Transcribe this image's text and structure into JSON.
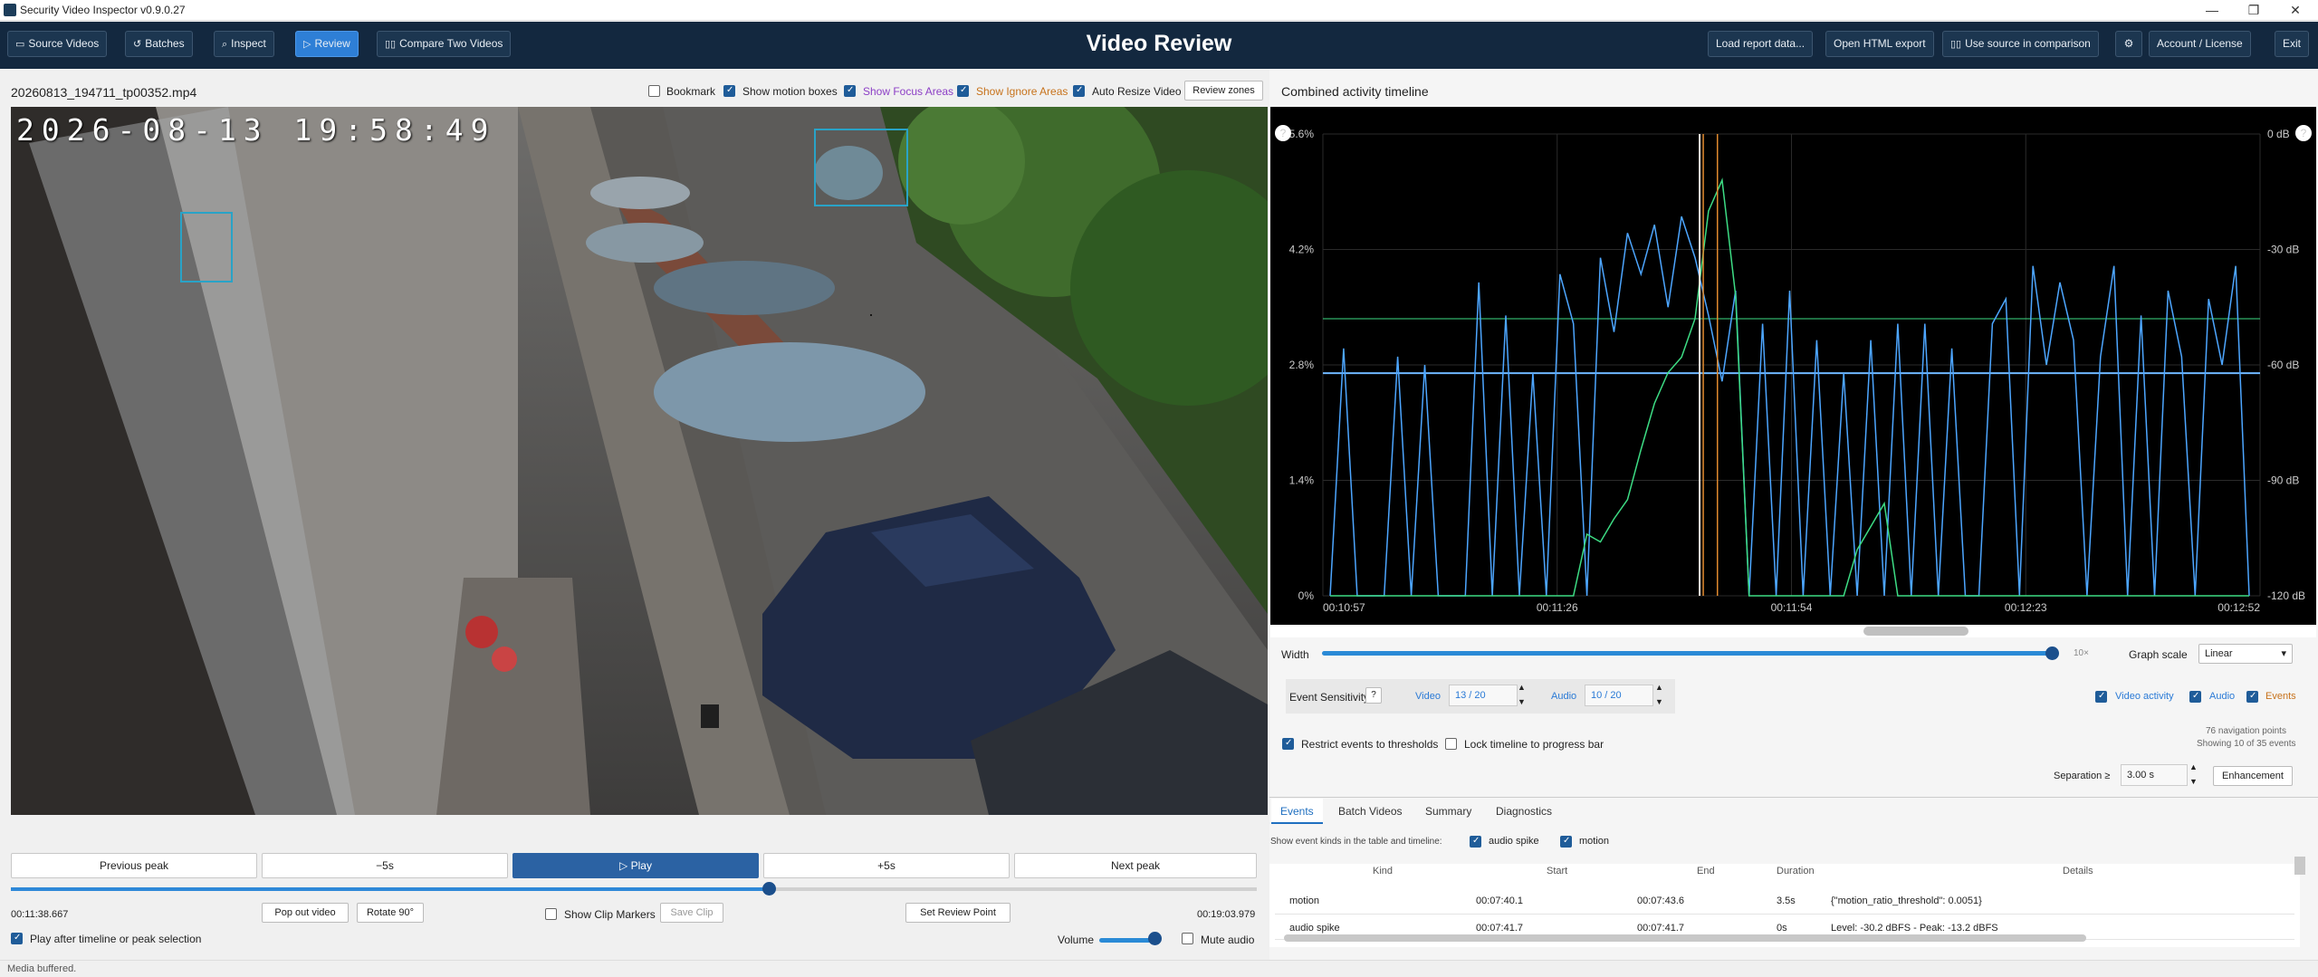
{
  "window": {
    "title": "Security Video Inspector v0.9.0.27",
    "minimize": "—",
    "maximize": "❐",
    "close": "✕"
  },
  "toolbar": {
    "source_videos": "Source Videos",
    "batches": "Batches",
    "inspect": "Inspect",
    "review": "Review",
    "compare": "Compare Two Videos",
    "title": "Video Review",
    "load_report": "Load report data...",
    "open_html": "Open HTML export",
    "use_source": "Use source in comparison",
    "account": "Account / License",
    "exit": "Exit"
  },
  "video": {
    "filename": "20260813_194711_tp00352.mp4",
    "timestamp_overlay": "2026-08-13 19:58:49",
    "options": {
      "bookmark": "Bookmark",
      "show_motion_boxes": "Show motion boxes",
      "show_focus_areas": "Show Focus Areas",
      "show_ignore_areas": "Show Ignore Areas",
      "auto_resize": "Auto Resize Video",
      "review_zones": "Review zones"
    },
    "option_states": {
      "bookmark": false,
      "show_motion_boxes": true,
      "show_focus_areas": true,
      "show_ignore_areas": true,
      "auto_resize": true
    }
  },
  "playback": {
    "previous_peak": "Previous peak",
    "back5": "−5s",
    "play": "Play",
    "fwd5": "+5s",
    "next_peak": "Next peak",
    "current_time": "00:11:38.667",
    "total_time": "00:19:03.979",
    "progress_fraction": 0.61,
    "pop_out": "Pop out video",
    "rotate": "Rotate 90°",
    "show_clip_markers": "Show Clip Markers",
    "save_clip": "Save Clip",
    "set_review_point": "Set Review Point",
    "play_after": "Play after timeline or peak selection",
    "volume": "Volume",
    "volume_fraction": 0.85,
    "mute": "Mute audio"
  },
  "timeline": {
    "title": "Combined activity timeline",
    "help": "?",
    "y_left": [
      "5.6%",
      "4.2%",
      "2.8%",
      "1.4%",
      "0%"
    ],
    "y_right": [
      "0 dB",
      "-30 dB",
      "-60 dB",
      "-90 dB",
      "-120 dB"
    ],
    "x_ticks": [
      "00:10:57",
      "00:11:26",
      "00:11:54",
      "00:12:23",
      "00:12:52"
    ],
    "width_label": "Width",
    "width_value": "10×",
    "graph_scale_label": "Graph scale",
    "graph_scale_value": "Linear",
    "colors": {
      "video": "#4da6ff",
      "audio": "#3ddc84",
      "threshold_video": "#6fb8ff",
      "threshold_audio": "#3ddc84",
      "event_marker": "#e08a2e"
    }
  },
  "chart_data": {
    "type": "line",
    "x_range": [
      "00:10:57",
      "00:12:52"
    ],
    "ylim_left_percent": [
      0,
      5.6
    ],
    "ylim_right_db": [
      -120,
      0
    ],
    "series": [
      {
        "name": "Video activity",
        "axis": "left",
        "values": [
          0,
          3.0,
          0,
          0,
          0,
          2.9,
          0,
          2.8,
          0,
          0,
          0,
          3.8,
          0,
          3.4,
          0,
          2.7,
          0,
          3.9,
          3.3,
          0,
          4.1,
          3.2,
          4.4,
          3.9,
          4.5,
          3.5,
          4.6,
          4.1,
          3.4,
          2.6,
          3.7,
          0,
          3.3,
          0,
          3.7,
          0,
          3.1,
          0,
          2.7,
          0,
          3.1,
          0,
          3.3,
          0,
          3.3,
          0,
          3.0,
          0,
          0,
          3.3,
          3.6,
          0,
          4.0,
          2.8,
          3.8,
          3.1,
          0,
          2.9,
          4.0,
          0,
          3.4,
          0,
          3.7,
          2.9,
          0,
          3.6,
          2.8,
          4.0,
          0
        ]
      },
      {
        "name": "Audio",
        "axis": "right",
        "values": [
          -120,
          -120,
          -120,
          -120,
          -120,
          -120,
          -120,
          -120,
          -120,
          -120,
          -120,
          -120,
          -120,
          -120,
          -120,
          -120,
          -120,
          -120,
          -120,
          -104,
          -106,
          -100,
          -95,
          -82,
          -70,
          -62,
          -58,
          -48,
          -20,
          -12,
          -42,
          -120,
          -120,
          -120,
          -120,
          -120,
          -120,
          -120,
          -120,
          -108,
          -102,
          -96,
          -120,
          -120,
          -120,
          -120,
          -120,
          -120,
          -120,
          -120,
          -120,
          -120,
          -120,
          -120,
          -120,
          -120,
          -120,
          -120,
          -120,
          -120,
          -120,
          -120,
          -120,
          -120,
          -120,
          -120,
          -120,
          -120,
          -120
        ]
      }
    ],
    "thresholds": {
      "video_percent": 2.7,
      "audio_db": -48
    },
    "markers": [
      "00:11:38",
      "00:11:42"
    ]
  },
  "sensitivity": {
    "label": "Event Sensitivity",
    "help": "?",
    "video_label": "Video",
    "video_value": "13 / 20",
    "audio_label": "Audio",
    "audio_value": "10 / 20",
    "video_activity": "Video activity",
    "audio": "Audio",
    "events": "Events",
    "restrict": "Restrict events to thresholds",
    "lock": "Lock timeline to progress bar",
    "nav_points": "76 navigation points",
    "showing": "Showing 10 of 35 events",
    "separation_label": "Separation ≥",
    "separation_value": "3.00 s",
    "enhancement": "Enhancement"
  },
  "tabs": [
    "Events",
    "Batch Videos",
    "Summary",
    "Diagnostics"
  ],
  "events_filter": {
    "label": "Show event kinds in the table and timeline:",
    "audio_spike": "audio spike",
    "motion": "motion"
  },
  "table": {
    "headers": [
      "Kind",
      "Start",
      "End",
      "Duration",
      "Details"
    ],
    "rows": [
      [
        "motion",
        "00:07:40.1",
        "00:07:43.6",
        "3.5s",
        "{\"motion_ratio_threshold\": 0.0051}"
      ],
      [
        "audio spike",
        "00:07:41.7",
        "00:07:41.7",
        "0s",
        "Level: -30.2 dBFS - Peak: -13.2 dBFS"
      ]
    ]
  },
  "status": "Media buffered."
}
